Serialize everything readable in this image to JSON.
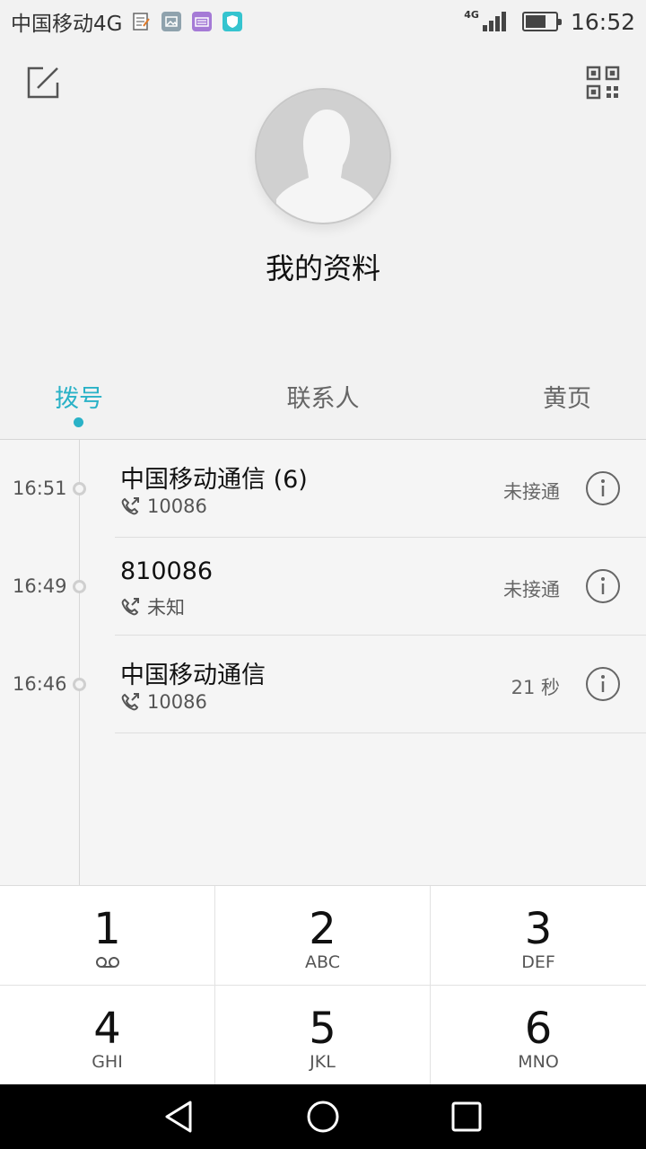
{
  "status_bar": {
    "carrier": "中国移动4G",
    "network_type": "4G",
    "time": "16:52",
    "battery_level": 0.7,
    "notification_icons": [
      "notes-icon",
      "gallery-icon",
      "keyboard-icon",
      "shield-icon"
    ]
  },
  "profile": {
    "name": "我的资料",
    "edit_icon": "edit-icon",
    "qr_icon": "qr-code-icon"
  },
  "tabs": [
    {
      "label": "拨号",
      "active": true
    },
    {
      "label": "联系人",
      "active": false
    },
    {
      "label": "黄页",
      "active": false
    }
  ],
  "calls": [
    {
      "time": "16:51",
      "name": "中国移动通信 (6)",
      "number": "10086",
      "status": "未接通"
    },
    {
      "time": "16:49",
      "name": "810086",
      "number": "未知",
      "status": "未接通"
    },
    {
      "time": "16:46",
      "name": "中国移动通信",
      "number": "10086",
      "status": "21 秒"
    }
  ],
  "dialpad": [
    {
      "digit": "1",
      "letters": "",
      "icon": "voicemail-icon"
    },
    {
      "digit": "2",
      "letters": "ABC"
    },
    {
      "digit": "3",
      "letters": "DEF"
    },
    {
      "digit": "4",
      "letters": "GHI"
    },
    {
      "digit": "5",
      "letters": "JKL"
    },
    {
      "digit": "6",
      "letters": "MNO"
    }
  ],
  "colors": {
    "accent": "#2ab2c7",
    "background": "#f2f2f2"
  }
}
